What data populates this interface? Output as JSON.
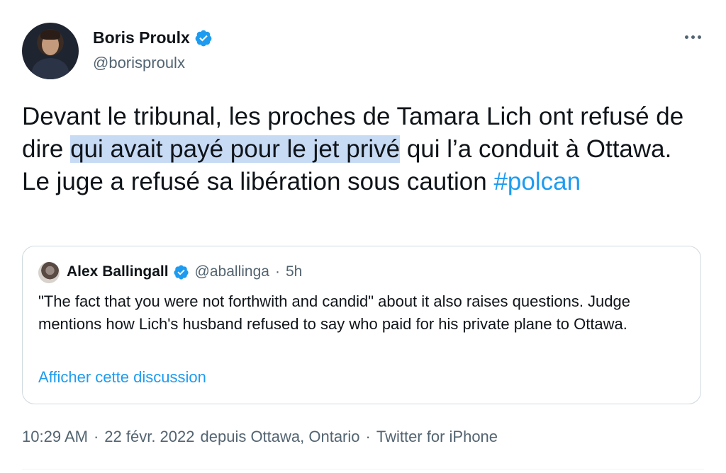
{
  "author": {
    "name": "Boris Proulx",
    "handle": "@borisproulx"
  },
  "tweet": {
    "text_before": "Devant le tribunal, les proches de Tamara Lich ont refusé de dire ",
    "text_highlight": "qui avait payé pour le jet privé",
    "text_after": " qui l’a conduit à Ottawa. Le juge a refusé sa libération sous caution ",
    "hashtag": "#polcan"
  },
  "quote": {
    "name": "Alex Ballingall",
    "handle": "@aballinga",
    "dot": "·",
    "time": "5h",
    "text": "\"The fact that you were not forthwith and candid\" about it also raises questions. Judge mentions how Lich's husband refused to say who paid for his private plane to Ottawa.",
    "link": "Afficher cette discussion"
  },
  "meta": {
    "time": "10:29 AM",
    "sep1": "·",
    "date": "22 févr. 2022",
    "location": "depuis Ottawa, Ontario",
    "sep2": "·",
    "client": "Twitter for iPhone"
  },
  "icons": {
    "verified": "verified-badge-icon",
    "more": "more-options-icon"
  },
  "colors": {
    "accent": "#1d9bf0",
    "highlight": "#c8dbf5",
    "secondary_text": "#536471"
  }
}
